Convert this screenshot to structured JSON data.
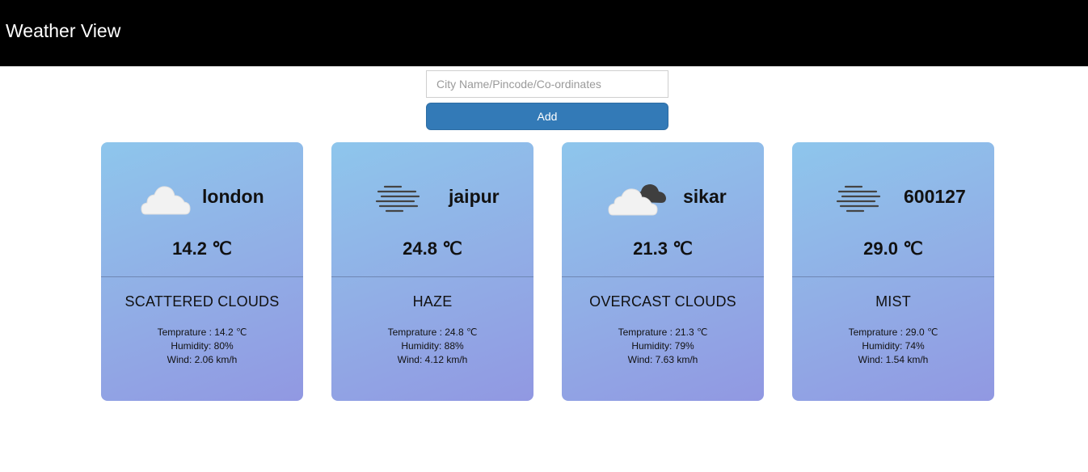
{
  "header": {
    "title": "Weather View"
  },
  "search": {
    "placeholder": "City Name/Pincode/Co-ordinates",
    "value": ""
  },
  "add_button": {
    "label": "Add"
  },
  "cards": [
    {
      "name": "london",
      "icon": "scattered-clouds-icon",
      "temp": "14.2",
      "unit": "℃",
      "description": "SCATTERED CLOUDS",
      "temp_line": "Temprature : 14.2 ℃",
      "humidity_line": "Humidity: 80%",
      "wind_line": "Wind: 2.06 km/h"
    },
    {
      "name": "jaipur",
      "icon": "haze-icon",
      "temp": "24.8",
      "unit": "℃",
      "description": "HAZE",
      "temp_line": "Temprature : 24.8 ℃",
      "humidity_line": "Humidity: 88%",
      "wind_line": "Wind: 4.12 km/h"
    },
    {
      "name": "sikar",
      "icon": "overcast-clouds-icon",
      "temp": "21.3",
      "unit": "℃",
      "description": "OVERCAST CLOUDS",
      "temp_line": "Temprature : 21.3 ℃",
      "humidity_line": "Humidity: 79%",
      "wind_line": "Wind: 7.63 km/h"
    },
    {
      "name": "600127",
      "icon": "mist-icon",
      "temp": "29.0",
      "unit": "℃",
      "description": "MIST",
      "temp_line": "Temprature : 29.0 ℃",
      "humidity_line": "Humidity: 74%",
      "wind_line": "Wind: 1.54 km/h"
    }
  ]
}
